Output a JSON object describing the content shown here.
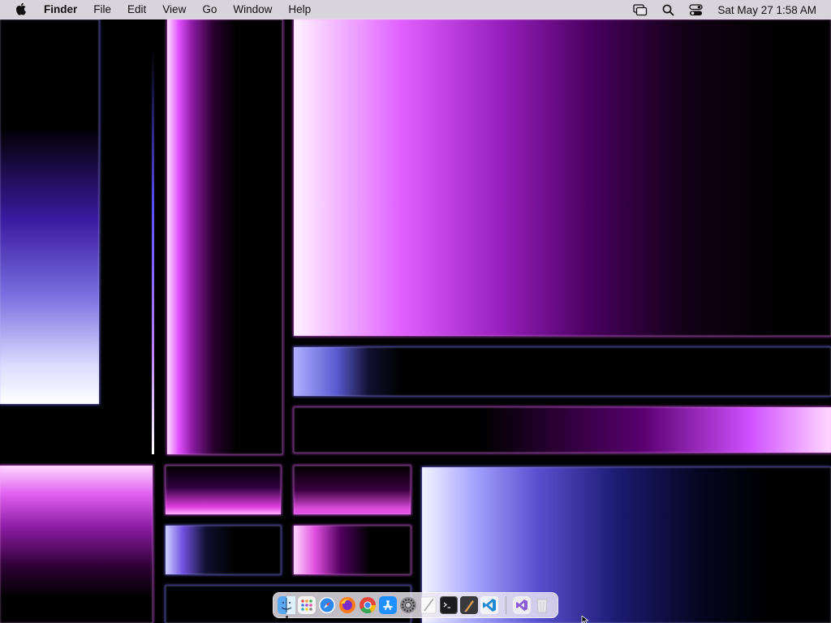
{
  "menubar": {
    "app_name": "Finder",
    "menus": [
      "File",
      "Edit",
      "View",
      "Go",
      "Window",
      "Help"
    ],
    "status_icons": [
      "screen-mirroring-icon",
      "spotlight-search-icon",
      "control-center-icon"
    ],
    "clock": "Sat May 27  1:58 AM"
  },
  "dock": {
    "apps": [
      {
        "name": "Finder",
        "icon": "finder-icon",
        "running": true
      },
      {
        "name": "Launchpad",
        "icon": "launchpad-icon",
        "running": false
      },
      {
        "name": "Safari",
        "icon": "safari-icon",
        "running": false
      },
      {
        "name": "Firefox",
        "icon": "firefox-icon",
        "running": false
      },
      {
        "name": "Google Chrome",
        "icon": "chrome-icon",
        "running": false
      },
      {
        "name": "App Store",
        "icon": "app-store-icon",
        "running": false
      },
      {
        "name": "System Settings",
        "icon": "system-settings-icon",
        "running": false
      },
      {
        "name": "TextEdit",
        "icon": "textedit-icon",
        "running": false
      },
      {
        "name": "Terminal",
        "icon": "terminal-icon",
        "running": false
      },
      {
        "name": "Script Editor",
        "icon": "script-editor-icon",
        "running": false
      },
      {
        "name": "Visual Studio Code",
        "icon": "vscode-icon",
        "running": false
      }
    ],
    "extras": [
      {
        "name": "Visual Studio",
        "icon": "visual-studio-icon"
      },
      {
        "name": "Trash",
        "icon": "trash-icon"
      }
    ]
  },
  "colors": {
    "menubar_bg": "#e8e4ec",
    "magenta": "#e050ff",
    "violet": "#6a3cf0",
    "periwinkle": "#8c8cff"
  }
}
